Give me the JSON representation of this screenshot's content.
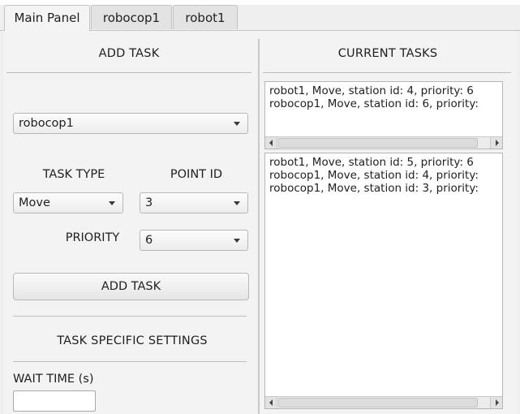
{
  "tabs": [
    {
      "label": "Main Panel",
      "active": true
    },
    {
      "label": "robocop1",
      "active": false
    },
    {
      "label": "robot1",
      "active": false
    }
  ],
  "add_task": {
    "heading": "ADD TASK",
    "robot_select": {
      "value": "robocop1"
    },
    "task_type": {
      "label": "TASK TYPE",
      "value": "Move"
    },
    "point_id": {
      "label": "POINT ID",
      "value": "3"
    },
    "priority": {
      "label": "PRIORITY",
      "value": "6"
    },
    "button_label": "ADD TASK",
    "specific_settings_heading": "TASK SPECIFIC SETTINGS",
    "wait_time": {
      "label": "WAIT TIME (s)",
      "value": ""
    }
  },
  "current_tasks": {
    "heading": "CURRENT TASKS",
    "list_top": [
      "robot1, Move, station id: 4, priority: 6",
      "robocop1, Move, station id: 6, priority:"
    ],
    "list_bottom": [
      "robot1, Move, station id: 5, priority: 6",
      "robocop1, Move, station id: 4, priority:",
      "robocop1, Move, station id: 3, priority:"
    ]
  }
}
